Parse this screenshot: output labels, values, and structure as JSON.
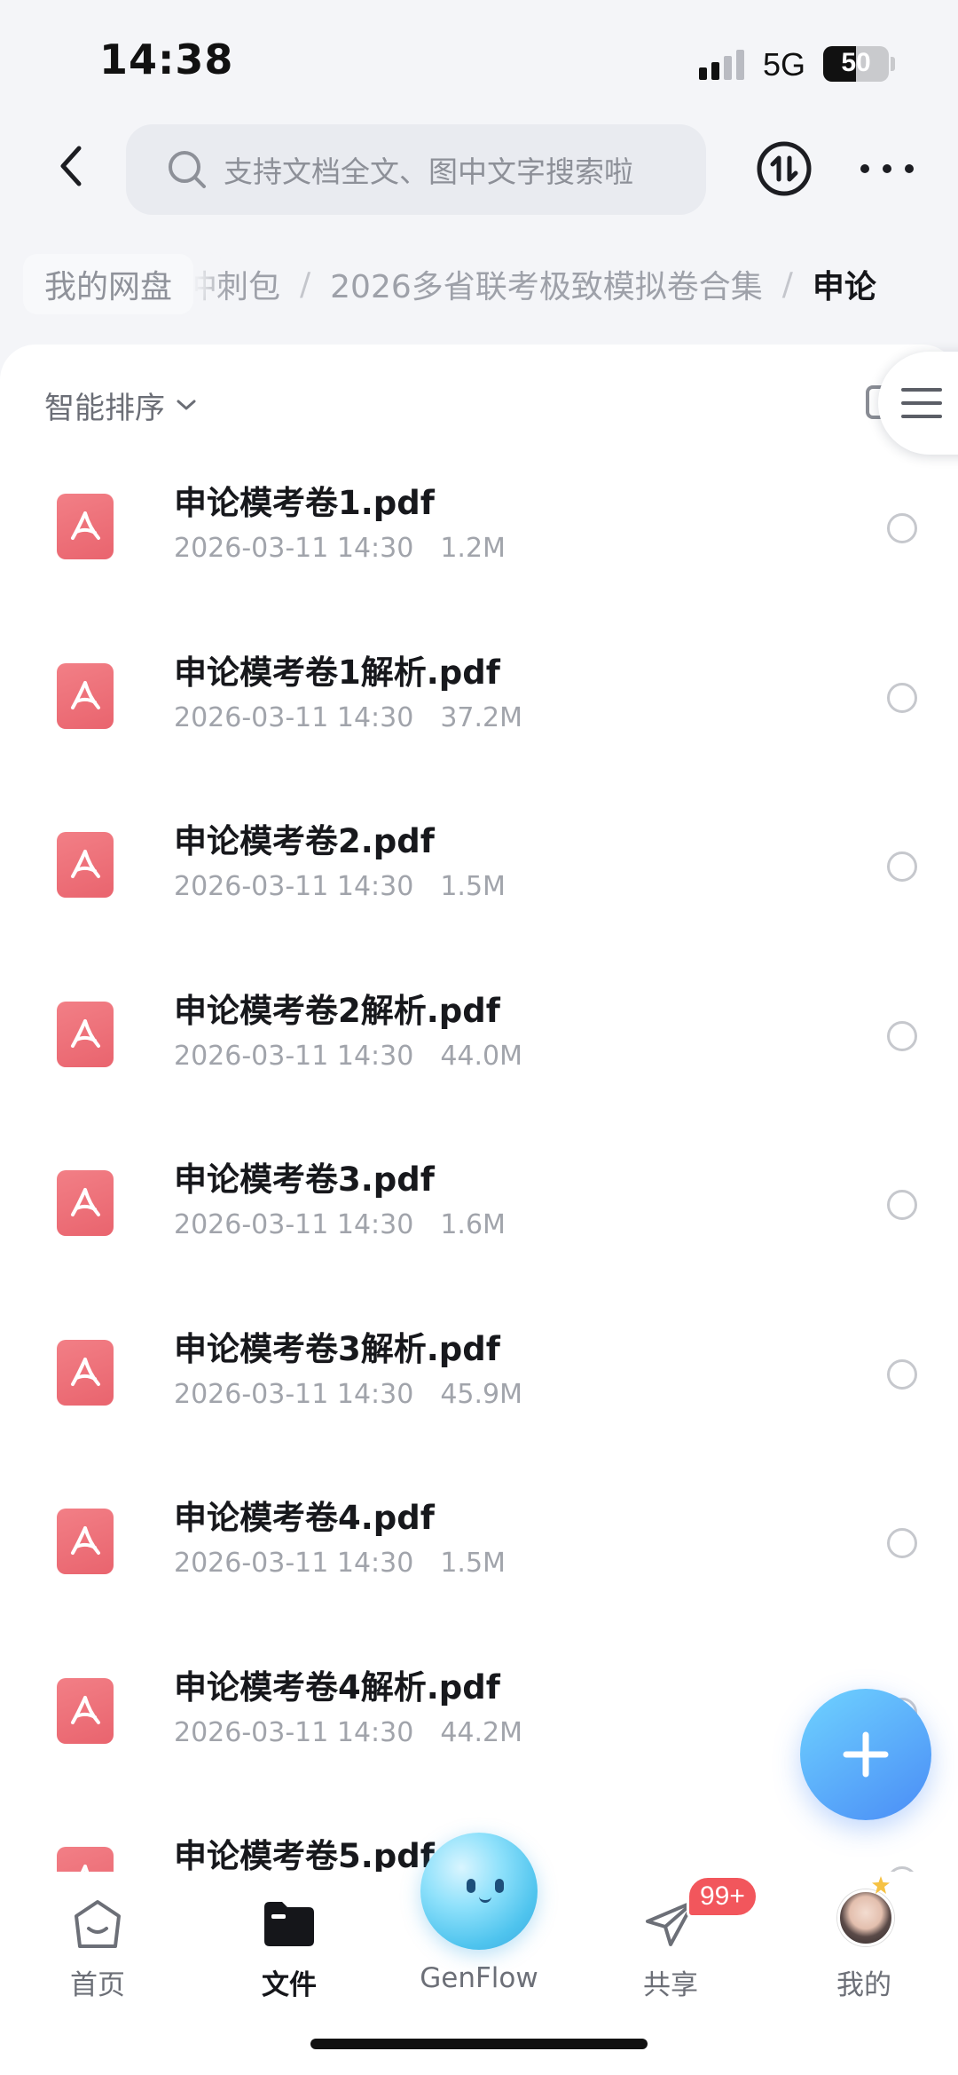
{
  "status_bar": {
    "time": "14:38",
    "network": "5G",
    "battery": "50",
    "battery_level": 0.5
  },
  "header": {
    "search_placeholder": "支持文档全文、图中文字搜索啦",
    "icons": {
      "back": "chevron-left-icon",
      "search": "search-icon",
      "transfer": "transfer-icon",
      "more": "more-icon"
    }
  },
  "breadcrumb": {
    "root": "我的网盘",
    "items": [
      "冲刺包",
      "2026多省联考极致模拟卷合集",
      "申论"
    ],
    "separator": "/"
  },
  "sort": {
    "label": "智能排序"
  },
  "files": [
    {
      "name": "申论模考卷1.pdf",
      "date": "2026-03-11 14:30",
      "size": "1.2M"
    },
    {
      "name": "申论模考卷1解析.pdf",
      "date": "2026-03-11 14:30",
      "size": "37.2M"
    },
    {
      "name": "申论模考卷2.pdf",
      "date": "2026-03-11 14:30",
      "size": "1.5M"
    },
    {
      "name": "申论模考卷2解析.pdf",
      "date": "2026-03-11 14:30",
      "size": "44.0M"
    },
    {
      "name": "申论模考卷3.pdf",
      "date": "2026-03-11 14:30",
      "size": "1.6M"
    },
    {
      "name": "申论模考卷3解析.pdf",
      "date": "2026-03-11 14:30",
      "size": "45.9M"
    },
    {
      "name": "申论模考卷4.pdf",
      "date": "2026-03-11 14:30",
      "size": "1.5M"
    },
    {
      "name": "申论模考卷4解析.pdf",
      "date": "2026-03-11 14:30",
      "size": "44.2M"
    },
    {
      "name": "申论模考卷5.pdf",
      "date": "",
      "size": ""
    }
  ],
  "tabs": [
    {
      "label": "首页",
      "icon": "home-icon"
    },
    {
      "label": "文件",
      "icon": "folder-icon",
      "active": true
    },
    {
      "label": "GenFlow",
      "icon": "genflow-orb-icon"
    },
    {
      "label": "共享",
      "icon": "send-icon",
      "badge": "99+"
    },
    {
      "label": "我的",
      "icon": "avatar-icon"
    }
  ],
  "colors": {
    "pdf": "#ec6d76",
    "accent": "#4a8cf6",
    "badge": "#f2565c"
  }
}
